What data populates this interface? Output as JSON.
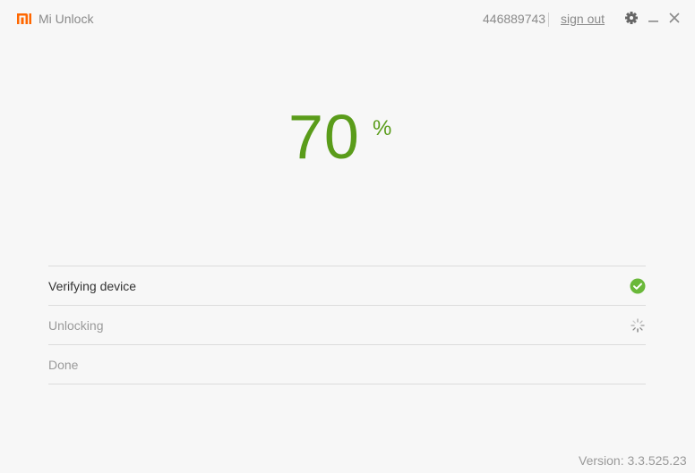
{
  "titlebar": {
    "app_title": "Mi Unlock",
    "logo_icon": "mi-logo-icon",
    "brand_color": "#ff6700",
    "account_id": "446889743",
    "sign_out_label": "sign out",
    "controls": [
      {
        "name": "settings",
        "icon": "gear-icon"
      },
      {
        "name": "minimize",
        "icon": "minimize-icon"
      },
      {
        "name": "close",
        "icon": "close-icon"
      }
    ]
  },
  "progress": {
    "value": "70",
    "unit": "%",
    "color": "#5a9c1a"
  },
  "steps": [
    {
      "label": "Verifying device",
      "status": "done",
      "icon": "check-circle-icon"
    },
    {
      "label": "Unlocking",
      "status": "in-progress",
      "icon": "spinner-icon"
    },
    {
      "label": "Done",
      "status": "pending",
      "icon": ""
    }
  ],
  "footer": {
    "version": "Version: 3.3.525.23"
  }
}
